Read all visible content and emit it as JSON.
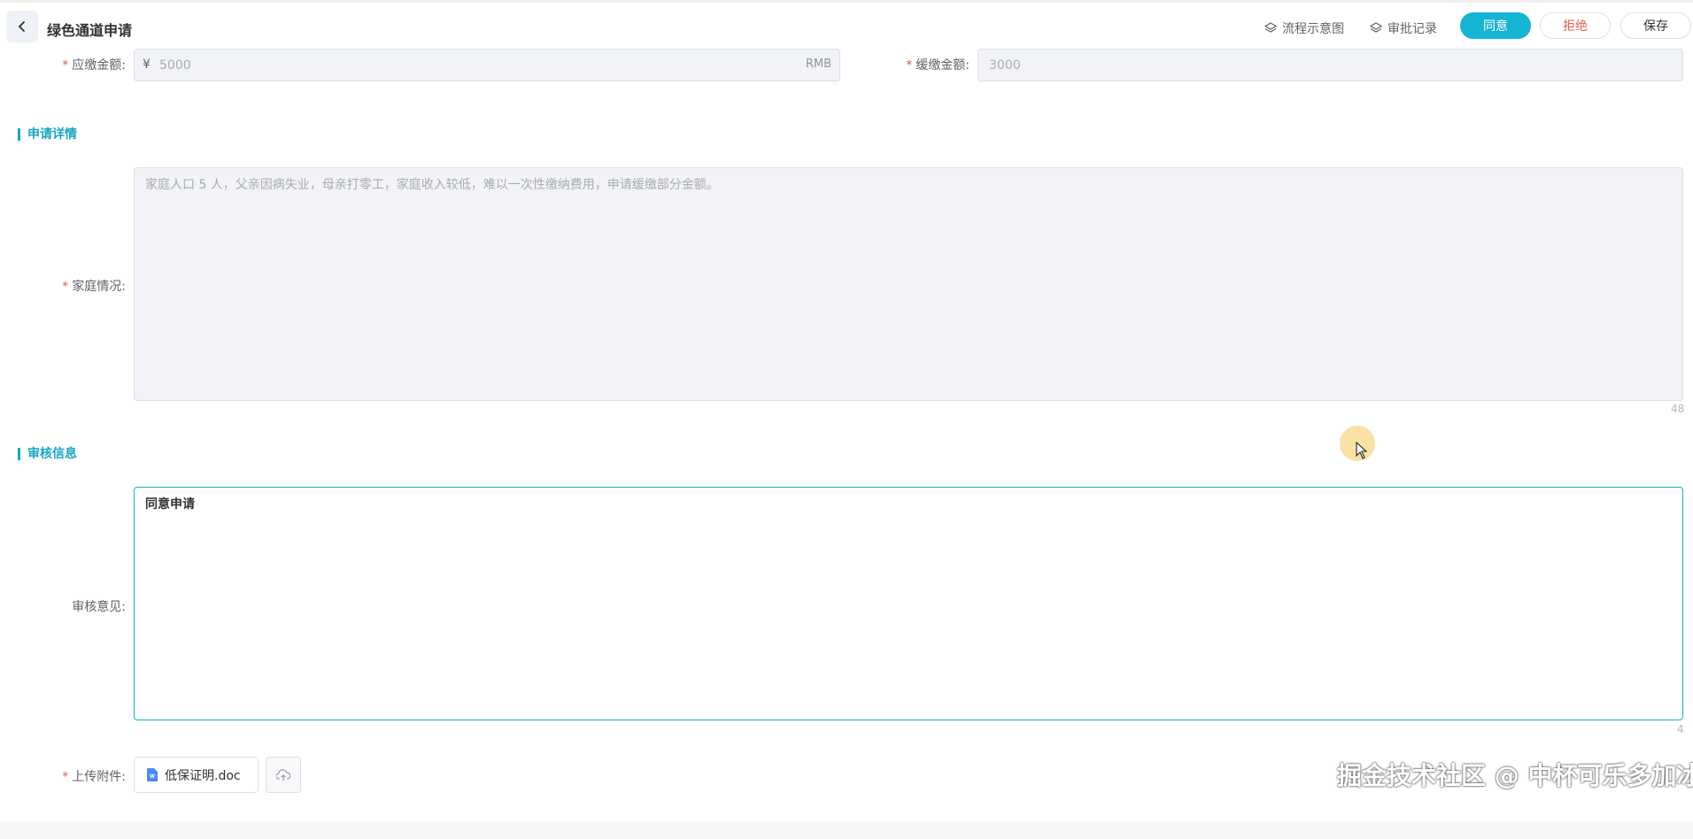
{
  "header": {
    "title": "绿色通道申请",
    "flow_link": "流程示意图",
    "history_link": "审批记录",
    "agree_label": "同意",
    "reject_label": "拒绝",
    "save_label": "保存"
  },
  "fees": {
    "due_label": "应缴金额:",
    "due_prefix": "¥",
    "due_value": "5000",
    "due_suffix": "RMB",
    "deferred_label": "缓缴金额:",
    "deferred_value": "3000"
  },
  "details": {
    "section_title": "申请详情",
    "family_label": "家庭情况:",
    "family_text": "家庭人口 5 人，父亲因病失业，母亲打零工，家庭收入较低，难以一次性缴纳费用，申请缓缴部分金额。",
    "family_count": "48"
  },
  "review": {
    "section_title": "审核信息",
    "opinion_label": "审核意见:",
    "opinion_text": "同意申请",
    "opinion_count": "4",
    "attachment_label": "上传附件:",
    "attachment_file": "低保证明.doc"
  },
  "watermark": "掘金技术社区 @ 中杯可乐多加冰",
  "colors": {
    "primary": "#16b4d3",
    "danger": "#e15b4f",
    "section": "#16a6c4"
  }
}
